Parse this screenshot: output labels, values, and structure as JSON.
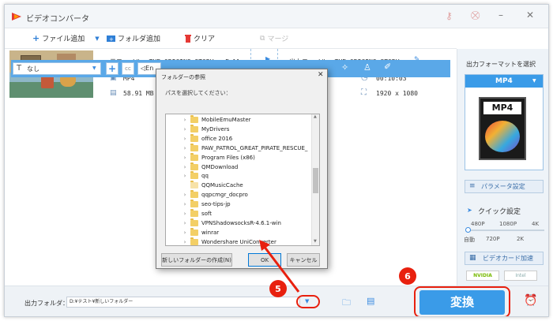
{
  "app": {
    "title": "ビデオコンバータ"
  },
  "toolbar": {
    "add_file": "ファイル追加",
    "add_folder": "フォルダ追加",
    "clear": "クリア",
    "merge": "マージ"
  },
  "file": {
    "source_label": "元ファイル: THE ORIGINS STORY - Full...",
    "format": "MP4",
    "size": "58.91 MB",
    "output_label": "出力ファイル: THE ORIGINS STORY...",
    "duration": "00:10:03",
    "resolution": "1920 x 1080"
  },
  "edit_bar": {
    "subtitle_select": "なし",
    "audio_partial": "En"
  },
  "sidebar": {
    "heading": "出力フォーマットを選択",
    "format": "MP4",
    "format_icon_text": "MP4",
    "param_button": "パラメータ設定",
    "quick_title": "クイック設定",
    "quality_top": [
      "480P",
      "1080P",
      "4K"
    ],
    "quality_bottom": [
      "自動",
      "720P",
      "2K"
    ],
    "gpu_button": "ビデオカード加速",
    "gpu_brands": [
      "NVIDIA",
      "Intel"
    ]
  },
  "bottom": {
    "output_label": "出力フォルダ：",
    "output_path": "D:¥テスト¥新しいフォルダー",
    "convert": "変換"
  },
  "dialog": {
    "title": "フォルダーの参照",
    "instruction": "パスを選択してください：",
    "folders": [
      "MobileEmuMaster",
      "MyDrivers",
      "office 2016",
      "PAW_PATROL_GREAT_PIRATE_RESCUE_",
      "Program Files (x86)",
      "QMDownload",
      "qq",
      "QQMusicCache",
      "qqpcmgr_docpro",
      "seo-tips-jp",
      "soft",
      "VPNShadowsocksR-4.6.1-win",
      "winrar",
      "Wondershare UniConverter"
    ],
    "new_folder": "新しいフォルダーの作成(N)",
    "ok": "OK",
    "cancel": "キャンセル"
  },
  "annotations": {
    "badge5": "5",
    "badge6": "6"
  },
  "colors": {
    "accent": "#3a9be8",
    "badge": "#e8200e",
    "bluebar": "#5aa8e8"
  }
}
